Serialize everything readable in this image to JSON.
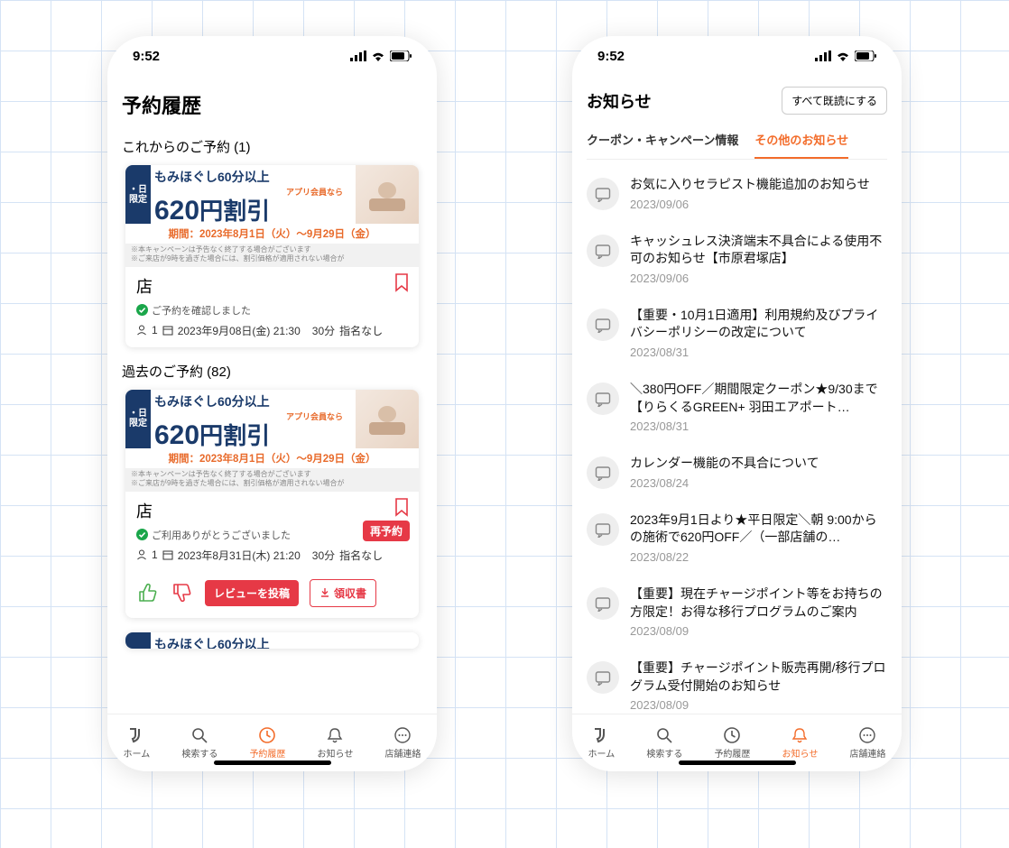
{
  "status_time": "9:52",
  "left": {
    "title": "予約履歴",
    "upcoming_header": "これからのご予約 (1)",
    "past_header": "過去のご予約 (82)",
    "banner": {
      "badge1": "・日",
      "badge2": "限定",
      "line1": "もみほぐし60分以上",
      "line2": "アプリ会員なら",
      "price_big": "620",
      "price_suffix": "円割引",
      "period": "期間：2023年8月1日（火）～9月29日（金）",
      "fine1": "※本キャンペーンは予告なく終了する場合がございます",
      "fine2": "※ご来店が9時を過ぎた場合には、割引価格が適用されない場合が"
    },
    "upcoming": {
      "store": "店",
      "status": "ご予約を確認しました",
      "persons": "1",
      "date": "2023年9月08日(金) 21:30",
      "duration": "30分",
      "staff": "指名なし"
    },
    "past": {
      "store": "店",
      "status": "ご利用ありがとうございました",
      "rebook": "再予約",
      "persons": "1",
      "date": "2023年8月31日(木) 21:20",
      "duration": "30分",
      "staff": "指名なし",
      "review_btn": "レビューを投稿",
      "receipt_btn": "領収書"
    }
  },
  "right": {
    "title": "お知らせ",
    "mark_all": "すべて既読にする",
    "tab1": "クーポン・キャンペーン情報",
    "tab2": "その他のお知らせ",
    "items": [
      {
        "text": "お気に入りセラピスト機能追加のお知らせ",
        "date": "2023/09/06"
      },
      {
        "text": "キャッシュレス決済端末不具合による使用不可のお知らせ【市原君塚店】",
        "date": "2023/09/06"
      },
      {
        "text": "【重要・10月1日適用】利用規約及びプライバシーポリシーの改定について",
        "date": "2023/08/31"
      },
      {
        "text": "＼380円OFF／期間限定クーポン★9/30まで【りらくるGREEN+ 羽田エアポート…",
        "date": "2023/08/31"
      },
      {
        "text": "カレンダー機能の不具合について",
        "date": "2023/08/24"
      },
      {
        "text": "2023年9月1日より★平日限定＼朝 9:00からの施術で620円OFF／（一部店舗の…",
        "date": "2023/08/22"
      },
      {
        "text": "【重要】現在チャージポイント等をお持ちの方限定！お得な移行プログラムのご案内",
        "date": "2023/08/09"
      },
      {
        "text": "【重要】チャージポイント販売再開/移行プログラム受付開始のお知らせ",
        "date": "2023/08/09"
      }
    ]
  },
  "tabs": {
    "home": "ホーム",
    "search": "検索する",
    "history": "予約履歴",
    "notif": "お知らせ",
    "contact": "店舗連絡"
  }
}
